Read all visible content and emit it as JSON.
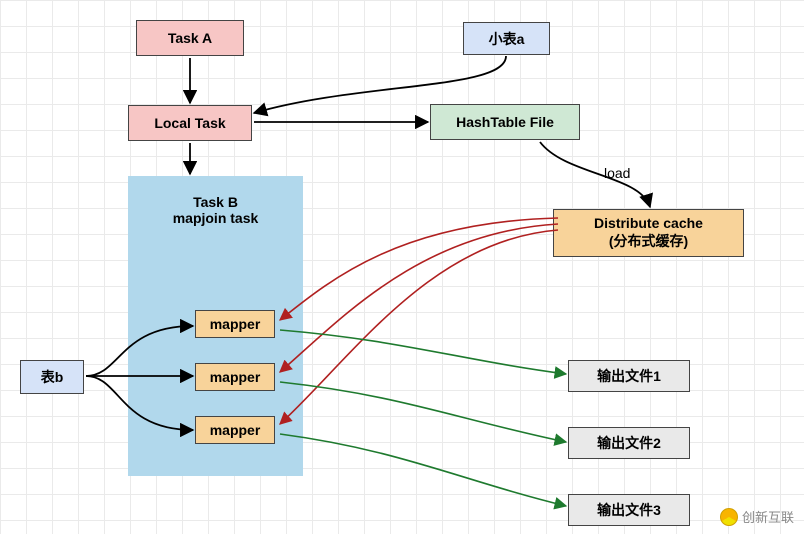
{
  "nodes": {
    "taskA": "Task A",
    "smallTableA": "小表a",
    "localTask": "Local Task",
    "hashTableFile": "HashTable File",
    "taskBTitle1": "Task B",
    "taskBTitle2": "mapjoin task",
    "mapper1": "mapper",
    "mapper2": "mapper",
    "mapper3": "mapper",
    "tableB": "表b",
    "distributeCache1": "Distribute cache",
    "distributeCache2": "(分布式缓存)",
    "out1": "输出文件1",
    "out2": "输出文件2",
    "out3": "输出文件3"
  },
  "labels": {
    "load": "load"
  },
  "watermark": "创新互联",
  "chart_data": {
    "type": "flow-diagram",
    "nodes": [
      {
        "id": "taskA",
        "label": "Task A",
        "kind": "task"
      },
      {
        "id": "smallTableA",
        "label": "小表a",
        "kind": "small-table"
      },
      {
        "id": "localTask",
        "label": "Local Task",
        "kind": "task"
      },
      {
        "id": "hashTableFile",
        "label": "HashTable File",
        "kind": "file"
      },
      {
        "id": "distributeCache",
        "label": "Distribute cache (分布式缓存)",
        "kind": "cache"
      },
      {
        "id": "taskB",
        "label": "Task B mapjoin task",
        "kind": "task-group"
      },
      {
        "id": "mapper1",
        "label": "mapper",
        "kind": "mapper",
        "parent": "taskB"
      },
      {
        "id": "mapper2",
        "label": "mapper",
        "kind": "mapper",
        "parent": "taskB"
      },
      {
        "id": "mapper3",
        "label": "mapper",
        "kind": "mapper",
        "parent": "taskB"
      },
      {
        "id": "tableB",
        "label": "表b",
        "kind": "table"
      },
      {
        "id": "out1",
        "label": "输出文件1",
        "kind": "output"
      },
      {
        "id": "out2",
        "label": "输出文件2",
        "kind": "output"
      },
      {
        "id": "out3",
        "label": "输出文件3",
        "kind": "output"
      }
    ],
    "edges": [
      {
        "from": "taskA",
        "to": "localTask"
      },
      {
        "from": "smallTableA",
        "to": "localTask"
      },
      {
        "from": "localTask",
        "to": "hashTableFile"
      },
      {
        "from": "hashTableFile",
        "to": "distributeCache",
        "label": "load"
      },
      {
        "from": "localTask",
        "to": "taskB"
      },
      {
        "from": "tableB",
        "to": "mapper1"
      },
      {
        "from": "tableB",
        "to": "mapper2"
      },
      {
        "from": "tableB",
        "to": "mapper3"
      },
      {
        "from": "distributeCache",
        "to": "mapper1",
        "color": "red"
      },
      {
        "from": "distributeCache",
        "to": "mapper2",
        "color": "red"
      },
      {
        "from": "distributeCache",
        "to": "mapper3",
        "color": "red"
      },
      {
        "from": "mapper1",
        "to": "out1",
        "color": "green"
      },
      {
        "from": "mapper2",
        "to": "out2",
        "color": "green"
      },
      {
        "from": "mapper3",
        "to": "out3",
        "color": "green"
      }
    ]
  }
}
